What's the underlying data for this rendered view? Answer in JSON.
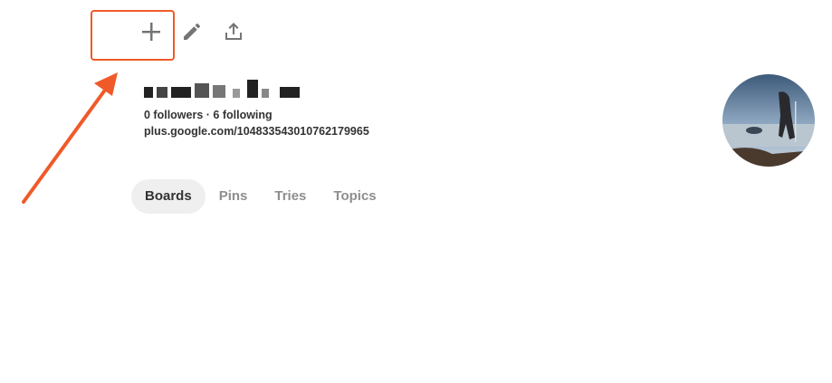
{
  "toolbar": {
    "add_icon": "plus-icon",
    "edit_icon": "pencil-icon",
    "share_icon": "share-upload-icon"
  },
  "profile": {
    "stats": "0 followers · 6 following",
    "link": "plus.google.com/104833543010762179965",
    "avatar_icon": "profile-avatar-photo"
  },
  "tabs": [
    {
      "label": "Boards",
      "active": true
    },
    {
      "label": "Pins",
      "active": false
    },
    {
      "label": "Tries",
      "active": false
    },
    {
      "label": "Topics",
      "active": false
    }
  ],
  "colors": {
    "highlight": "#f05a28",
    "arrow": "#f05a28",
    "active_tab_bg": "#efefef",
    "inactive_tab_text": "#8e8e8e",
    "icon_gray": "#757575"
  }
}
